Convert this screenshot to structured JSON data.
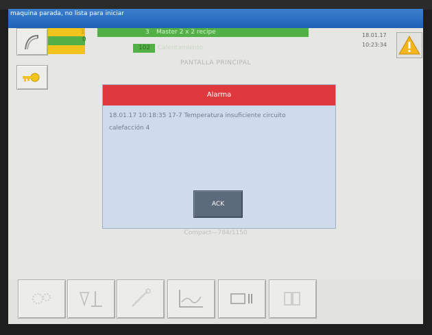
{
  "status": {
    "title": "maquina parada, no lista para iniciar"
  },
  "header": {
    "row1": {
      "count": "1",
      "index": "3",
      "recipe": "Master 2 x 2 recipe"
    },
    "row2": {
      "count": "0",
      "index": "102",
      "label": "Calentamiento"
    },
    "date": "18.01.17",
    "time": "10:23:34",
    "page_title": "PANTALLA PRINCIPAL"
  },
  "alarm": {
    "title": "Alarma",
    "message_line1": "18.01.17 10:18:35 17-7 Temperatura insuficiente circuito",
    "message_line2": "calefacción  4",
    "ack_label": "ACK"
  },
  "footer": {
    "machine": "Compact—784/1150"
  },
  "toolbar": {
    "icons": [
      "gears-icon",
      "tools-icon",
      "wrench-icon",
      "trend-chart-icon",
      "media-icon",
      "documents-icon"
    ]
  },
  "colors": {
    "title_bar": "#2a6fc4",
    "alarm_header": "#e0393d",
    "progress_green": "#52b046",
    "progress_yellow": "#f2c31c"
  }
}
